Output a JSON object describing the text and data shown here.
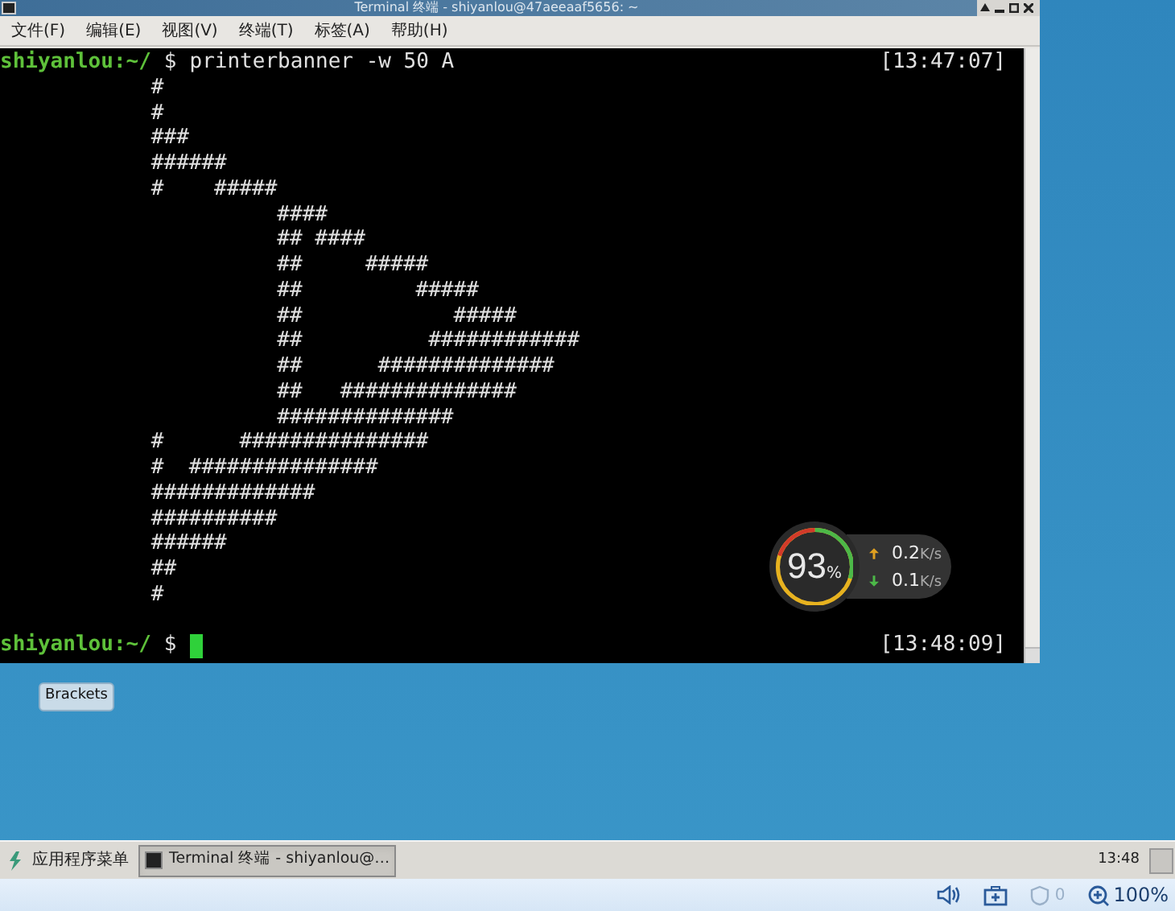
{
  "window": {
    "title": "Terminal 终端 - shiyanlou@47aeeaaf5656: ~",
    "menu": [
      {
        "label": "文件(F)"
      },
      {
        "label": "编辑(E)"
      },
      {
        "label": "视图(V)"
      },
      {
        "label": "终端(T)"
      },
      {
        "label": "标签(A)"
      },
      {
        "label": "帮助(H)"
      }
    ]
  },
  "terminal": {
    "lines": [
      {
        "kind": "prompt",
        "user": "shiyanlou:~/",
        "symbol": "$",
        "command": "printerbanner -w 50 A",
        "timestamp": "[13:47:07]",
        "cursor": false
      },
      {
        "kind": "output",
        "text": "            #"
      },
      {
        "kind": "output",
        "text": "            #"
      },
      {
        "kind": "output",
        "text": "            ###"
      },
      {
        "kind": "output",
        "text": "            ######"
      },
      {
        "kind": "output",
        "text": "            #    #####"
      },
      {
        "kind": "output",
        "text": "                      ####"
      },
      {
        "kind": "output",
        "text": "                      ## ####"
      },
      {
        "kind": "output",
        "text": "                      ##     #####"
      },
      {
        "kind": "output",
        "text": "                      ##         #####"
      },
      {
        "kind": "output",
        "text": "                      ##            #####"
      },
      {
        "kind": "output",
        "text": "                      ##          ############"
      },
      {
        "kind": "output",
        "text": "                      ##      ##############"
      },
      {
        "kind": "output",
        "text": "                      ##   ##############"
      },
      {
        "kind": "output",
        "text": "                      ##############"
      },
      {
        "kind": "output",
        "text": "            #      ###############"
      },
      {
        "kind": "output",
        "text": "            #  ###############"
      },
      {
        "kind": "output",
        "text": "            #############"
      },
      {
        "kind": "output",
        "text": "            ##########"
      },
      {
        "kind": "output",
        "text": "            ######"
      },
      {
        "kind": "output",
        "text": "            ##"
      },
      {
        "kind": "output",
        "text": "            #"
      },
      {
        "kind": "prompt",
        "user": "shiyanlou:~/",
        "symbol": "$",
        "timestamp": "[13:48:09]",
        "cursor": true
      }
    ]
  },
  "network_widget": {
    "percent": "93",
    "percent_unit": "%",
    "upload": "0.2",
    "upload_unit": "K/s",
    "download": "0.1",
    "download_unit": "K/s"
  },
  "desktop": {
    "icon_label": "Brackets"
  },
  "taskbar": {
    "menu_label": "应用程序菜单",
    "tasks": [
      {
        "label": "Terminal 终端 - shiyanlou@…",
        "selected": true
      }
    ],
    "clock": "13:48"
  },
  "status_bar": {
    "blocked_count": "0",
    "zoom": "100%"
  }
}
